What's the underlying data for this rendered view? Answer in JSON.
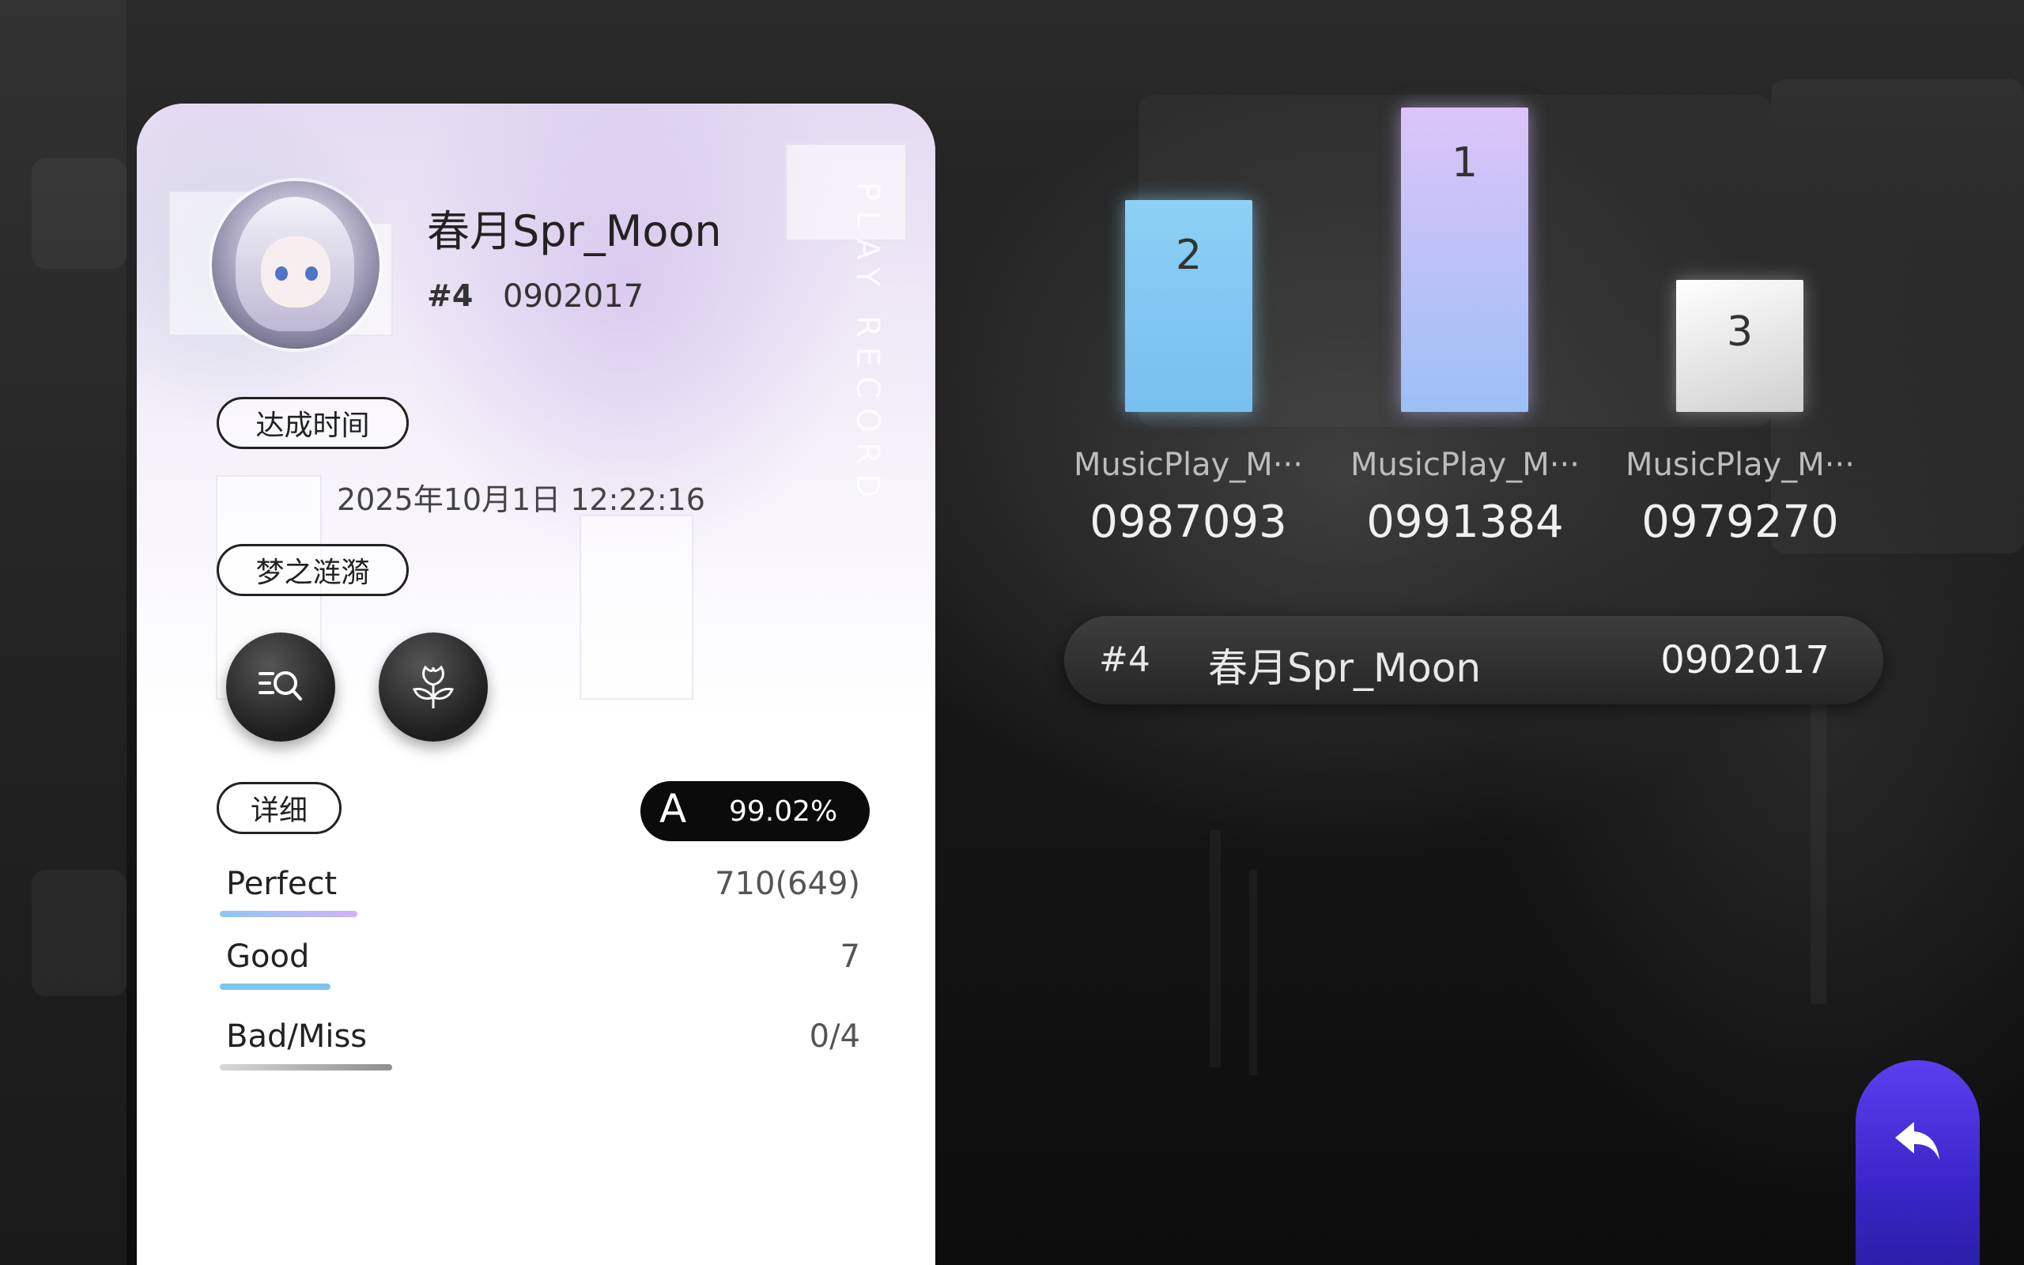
{
  "card": {
    "vertical_text": "PLAY RECORD",
    "player_name": "春月Spr_Moon",
    "player_rank": "#4",
    "player_score": "0902017",
    "achieve_label": "达成时间",
    "achieve_time": "2025年10月1日 12:22:16",
    "song_label": "梦之涟漪",
    "detail_label": "详细",
    "grade": "A",
    "accuracy": "99.02%",
    "judgements": [
      {
        "label": "Perfect",
        "value": "710(649)"
      },
      {
        "label": "Good",
        "value": "7"
      },
      {
        "label": "Bad/Miss",
        "value": "0/4"
      }
    ]
  },
  "leaderboard": {
    "podium": [
      {
        "place": "2",
        "name": "MusicPlay_M···",
        "score": "0987093"
      },
      {
        "place": "1",
        "name": "MusicPlay_M···",
        "score": "0991384"
      },
      {
        "place": "3",
        "name": "MusicPlay_M···",
        "score": "0979270"
      }
    ],
    "self": {
      "rank": "#4",
      "name": "春月Spr_Moon",
      "score": "0902017"
    }
  },
  "colors": {
    "accent": "#4a32e0",
    "perfect_bar": "#c6a8f5",
    "good_bar": "#7cc4ee",
    "miss_bar": "#9a9a9a"
  },
  "icons": {
    "search_list": "search-list-icon",
    "flower": "flower-icon",
    "back": "return-arrow-icon"
  }
}
